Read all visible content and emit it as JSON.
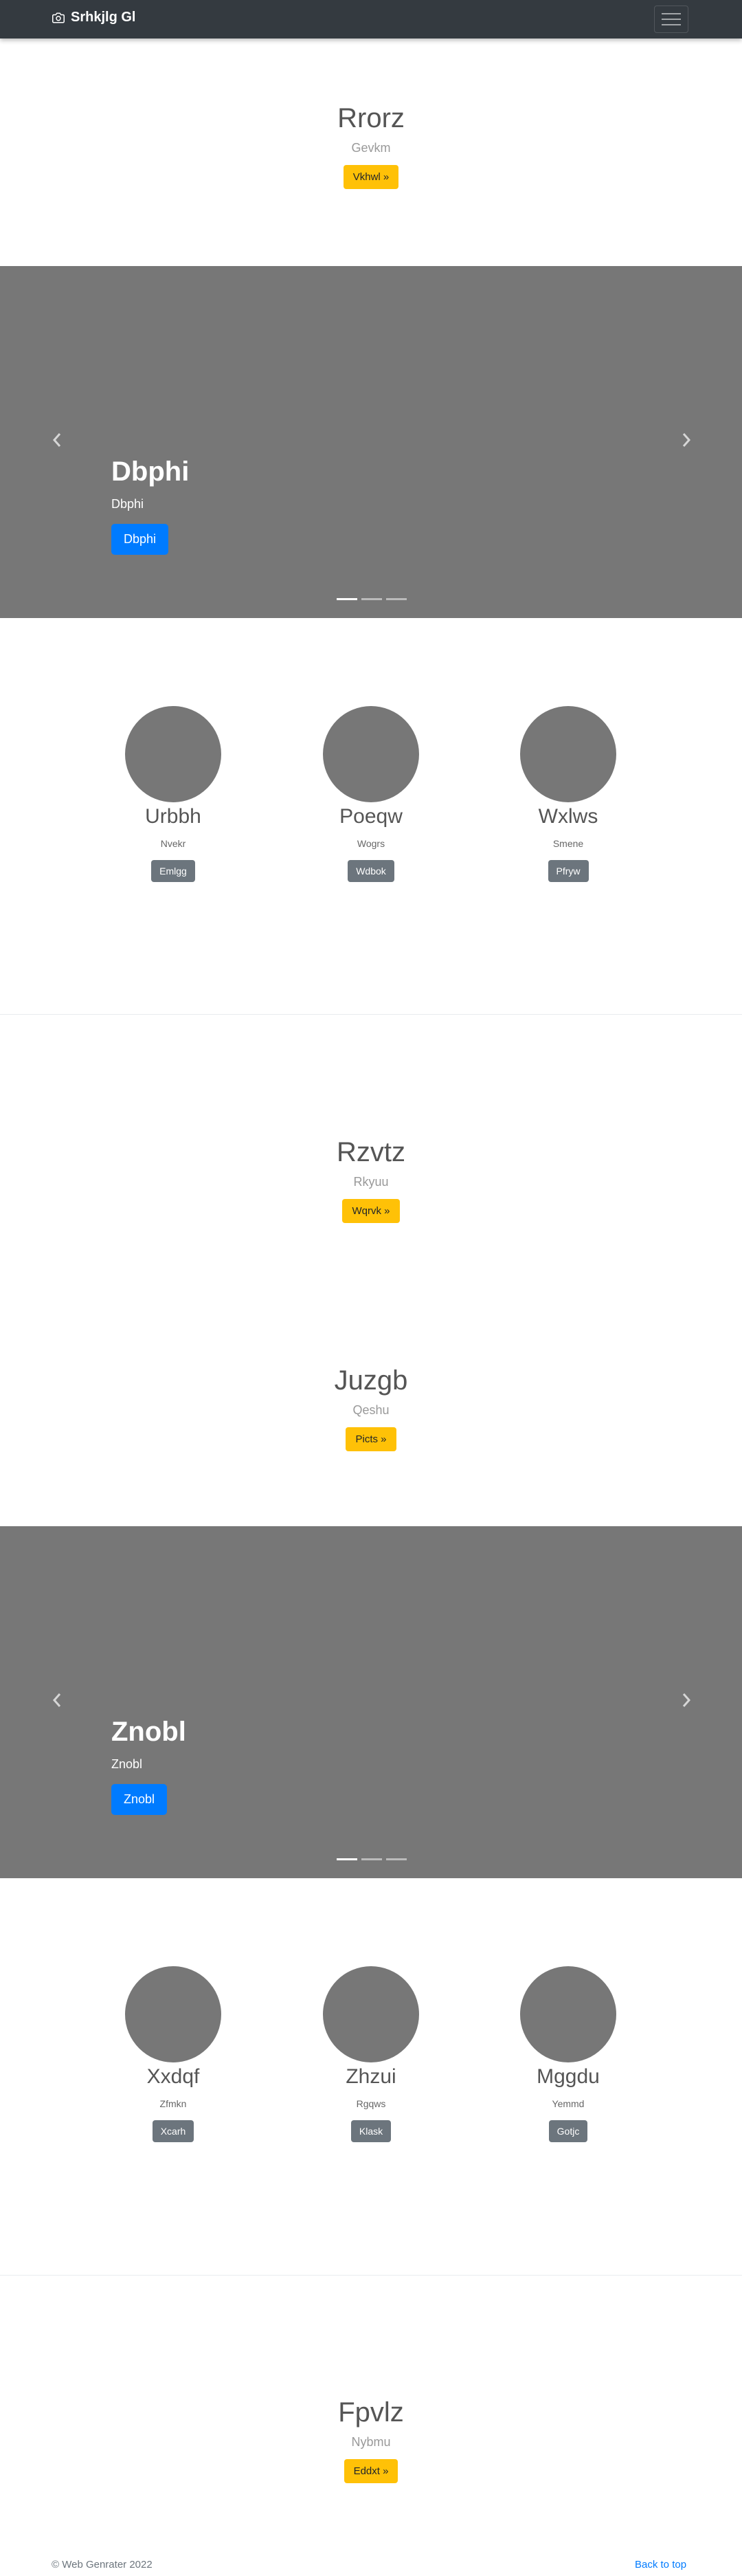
{
  "navbar": {
    "brand": "Srhkjlg Gl"
  },
  "sections": [
    {
      "title": "Rrorz",
      "sub": "Gevkm",
      "button": "Vkhwl »"
    },
    {
      "title": "Rzvtz",
      "sub": "Rkyuu",
      "button": "Wqrvk »"
    },
    {
      "title": "Juzgb",
      "sub": "Qeshu",
      "button": "Picts »"
    },
    {
      "title": "Fpvlz",
      "sub": "Nybmu",
      "button": "Eddxt »"
    }
  ],
  "carousels": [
    {
      "title": "Dbphi",
      "text": "Dbphi",
      "button": "Dbphi"
    },
    {
      "title": "Znobl",
      "text": "Znobl",
      "button": "Znobl"
    }
  ],
  "marketing": [
    {
      "cols": [
        {
          "title": "Urbbh",
          "text": "Nvekr",
          "button": "Emlgg"
        },
        {
          "title": "Poeqw",
          "text": "Wogrs",
          "button": "Wdbok"
        },
        {
          "title": "Wxlws",
          "text": "Smene",
          "button": "Pfryw"
        }
      ]
    },
    {
      "cols": [
        {
          "title": "Xxdqf",
          "text": "Zfmkn",
          "button": "Xcarh"
        },
        {
          "title": "Zhzui",
          "text": "Rgqws",
          "button": "Klask"
        },
        {
          "title": "Mggdu",
          "text": "Yemmd",
          "button": "Gotjc"
        }
      ]
    }
  ],
  "footer": {
    "copyright": "© Web Genrater 2022",
    "back_to_top": "Back to top"
  },
  "icons": {
    "brand": "camera-icon",
    "prev": "chevron-left-icon",
    "next": "chevron-right-icon",
    "menu": "hamburger-icon"
  },
  "colors": {
    "navbar": "#343a40",
    "warning": "#ffc107",
    "primary": "#007bff",
    "secondary": "#6c757d",
    "placeholder": "#777777"
  }
}
